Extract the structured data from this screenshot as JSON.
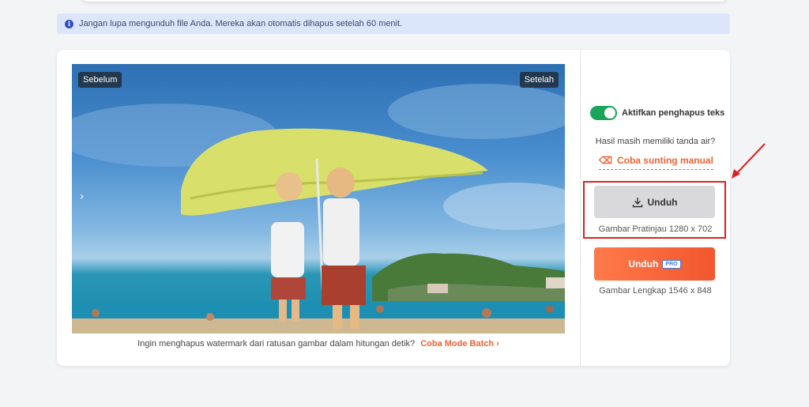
{
  "notice": {
    "icon": "info-icon",
    "text": "Jangan lupa mengunduh file Anda. Mereka akan otomatis dihapus setelah 60 menit."
  },
  "preview": {
    "before_label": "Sebelum",
    "after_label": "Setelah",
    "next_arrow": "›"
  },
  "batch": {
    "text": "Ingin menghapus watermark dari ratusan gambar dalam hitungan detik?",
    "link": "Coba Mode Batch",
    "link_icon": "›"
  },
  "sidebar": {
    "toggle_label": "Aktifkan penghapus teks",
    "toggle_on": true,
    "watermark_question": "Hasil masih memiliki tanda air?",
    "manual_edit_link": "Coba sunting manual",
    "download_label": "Unduh",
    "preview_size": "Gambar Pratinjau 1280 x 702",
    "pro_download_label": "Unduh",
    "pro_badge": "PRO",
    "full_size": "Gambar Lengkap 1546 x 848"
  },
  "colors": {
    "accent": "#f06232",
    "toggle": "#1aa55a",
    "highlight": "#e02020",
    "notice_bg": "#dce6fb"
  }
}
